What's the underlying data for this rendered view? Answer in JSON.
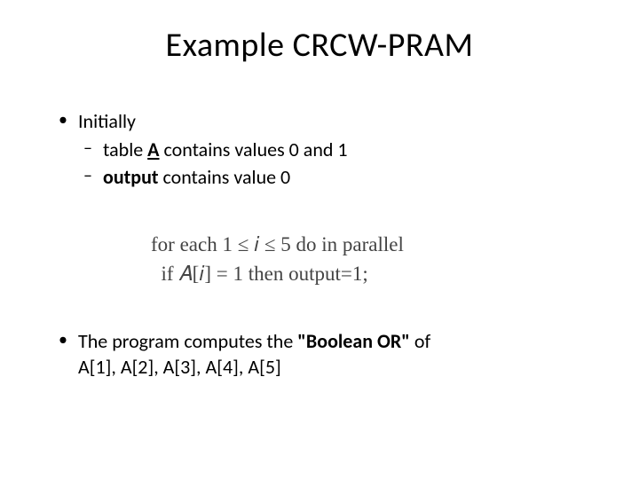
{
  "title": "Example  CRCW-PRAM",
  "bullets": {
    "b1": {
      "label": "Initially",
      "sub1_pre": "table ",
      "sub1_bold": "A",
      "sub1_post": " contains values 0 and 1",
      "sub2_bold": "output",
      "sub2_post": " contains value 0"
    },
    "b2": {
      "line1_pre": "The program computes the ",
      "line1_bold": "\"Boolean OR\"",
      "line1_post": " of",
      "line2": "A[1], A[2], A[3], A[4], A[5]"
    }
  },
  "math": {
    "line1": "for each 1 ≤ 𝑖 ≤ 5 do in parallel",
    "line2": "  if 𝐴[𝑖] = 1 then output=1;"
  }
}
